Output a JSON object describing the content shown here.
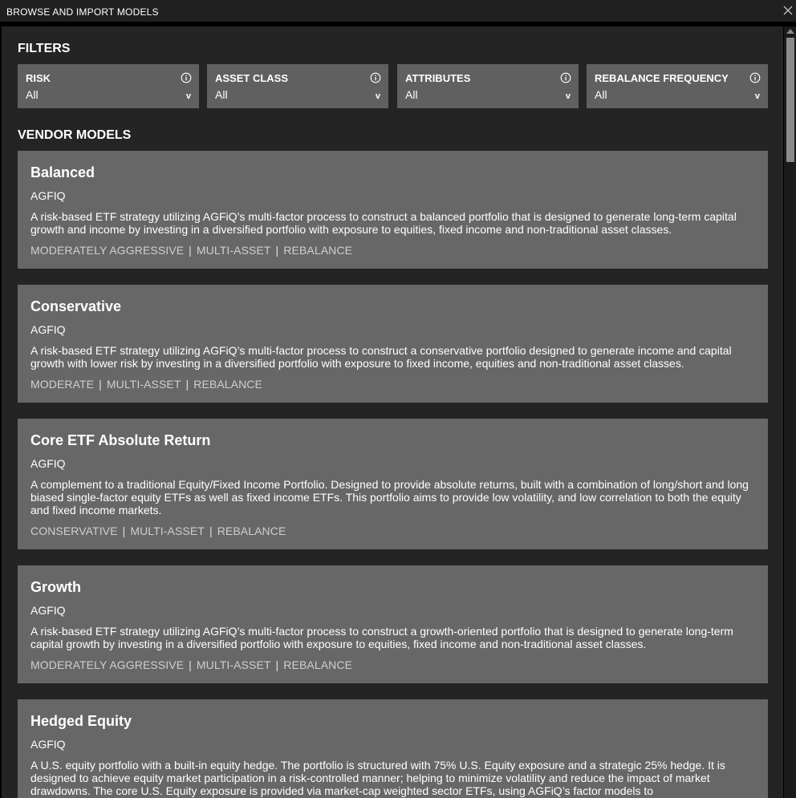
{
  "window": {
    "title": "BROWSE AND IMPORT MODELS",
    "close_icon": "close-icon"
  },
  "filters": {
    "heading": "FILTERS",
    "items": [
      {
        "label": "RISK",
        "value": "All",
        "info_icon": "info-icon",
        "chevron": "v"
      },
      {
        "label": "ASSET CLASS",
        "value": "All",
        "info_icon": "info-icon",
        "chevron": "v"
      },
      {
        "label": "ATTRIBUTES",
        "value": "All",
        "info_icon": "info-icon",
        "chevron": "v"
      },
      {
        "label": "REBALANCE FREQUENCY",
        "value": "All",
        "info_icon": "info-icon",
        "chevron": "v"
      }
    ]
  },
  "vendor_models": {
    "heading": "VENDOR MODELS",
    "items": [
      {
        "name": "Balanced",
        "vendor": "AGFIQ",
        "description": "A risk-based ETF strategy utilizing AGFiQ’s multi-factor process to construct a balanced portfolio that is designed to generate long-term capital growth and income by investing in a diversified portfolio with exposure to equities, fixed income and non-traditional asset classes.",
        "tags": [
          "MODERATELY AGGRESSIVE",
          "MULTI-ASSET",
          "REBALANCE"
        ]
      },
      {
        "name": "Conservative",
        "vendor": "AGFIQ",
        "description": "A risk-based ETF strategy utilizing AGFiQ’s multi-factor process to construct a conservative portfolio designed to generate income and capital growth with lower risk by investing in a diversified portfolio with exposure to fixed income, equities and non-traditional asset classes.",
        "tags": [
          "MODERATE",
          "MULTI-ASSET",
          "REBALANCE"
        ]
      },
      {
        "name": "Core ETF Absolute Return",
        "vendor": "AGFIQ",
        "description": "A complement to a traditional Equity/Fixed Income Portfolio. Designed to provide absolute returns, built with a combination of long/short and long biased single-factor equity ETFs as well as fixed income ETFs. This portfolio aims to provide low volatility, and low correlation to both the equity and fixed income markets.",
        "tags": [
          "CONSERVATIVE",
          "MULTI-ASSET",
          "REBALANCE"
        ]
      },
      {
        "name": "Growth",
        "vendor": "AGFIQ",
        "description": "A risk-based ETF strategy utilizing AGFiQ’s multi-factor process to construct a growth-oriented portfolio that is designed to generate long-term capital growth by investing in a diversified portfolio with exposure to equities, fixed income and non-traditional asset classes.",
        "tags": [
          "MODERATELY AGGRESSIVE",
          "MULTI-ASSET",
          "REBALANCE"
        ]
      },
      {
        "name": "Hedged Equity",
        "vendor": "AGFIQ",
        "description": "A U.S. equity portfolio with a built-in equity hedge. The portfolio is structured with 75% U.S. Equity exposure and a strategic 25% hedge. It is designed to achieve equity market participation in a risk-controlled manner; helping to minimize volatility and reduce the impact of market drawdowns. The core U.S. Equity exposure is provided via market-cap weighted sector ETFs, using AGFiQ’s factor models to",
        "tags": []
      }
    ]
  }
}
